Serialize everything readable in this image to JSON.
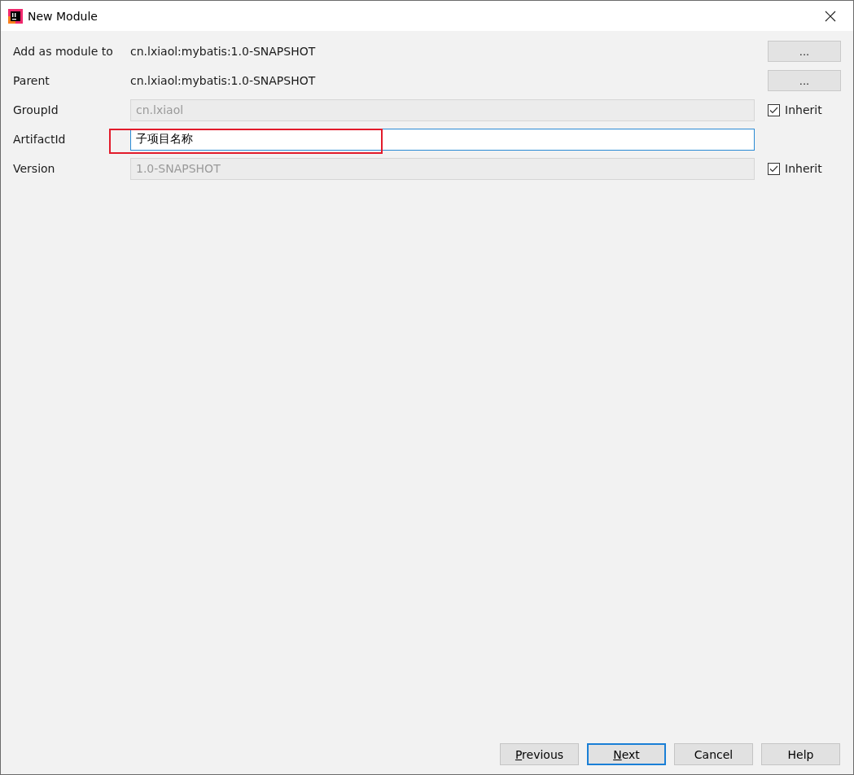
{
  "window": {
    "title": "New Module"
  },
  "rows": [
    {
      "kind": "text",
      "label": "Add as module to",
      "value": "cn.lxiaol:mybatis:1.0-SNAPSHOT",
      "button": "..."
    },
    {
      "kind": "text",
      "label": "Parent",
      "value": "cn.lxiaol:mybatis:1.0-SNAPSHOT",
      "button": "..."
    },
    {
      "kind": "field",
      "label": "GroupId",
      "value": "cn.lxiaol",
      "disabled": true,
      "focused": false,
      "checkbox": {
        "label": "Inherit",
        "checked": true
      }
    },
    {
      "kind": "field",
      "label": "ArtifactId",
      "value": "子项目名称",
      "disabled": false,
      "focused": true,
      "highlighted": true
    },
    {
      "kind": "field",
      "label": "Version",
      "value": "1.0-SNAPSHOT",
      "disabled": true,
      "focused": false,
      "checkbox": {
        "label": "Inherit",
        "checked": true
      }
    }
  ],
  "buttons": [
    {
      "label": "Previous",
      "mnemonic": true,
      "default": false
    },
    {
      "label": "Next",
      "mnemonic": true,
      "default": true
    },
    {
      "label": "Cancel",
      "mnemonic": false,
      "default": false
    },
    {
      "label": "Help",
      "mnemonic": false,
      "default": false
    }
  ]
}
